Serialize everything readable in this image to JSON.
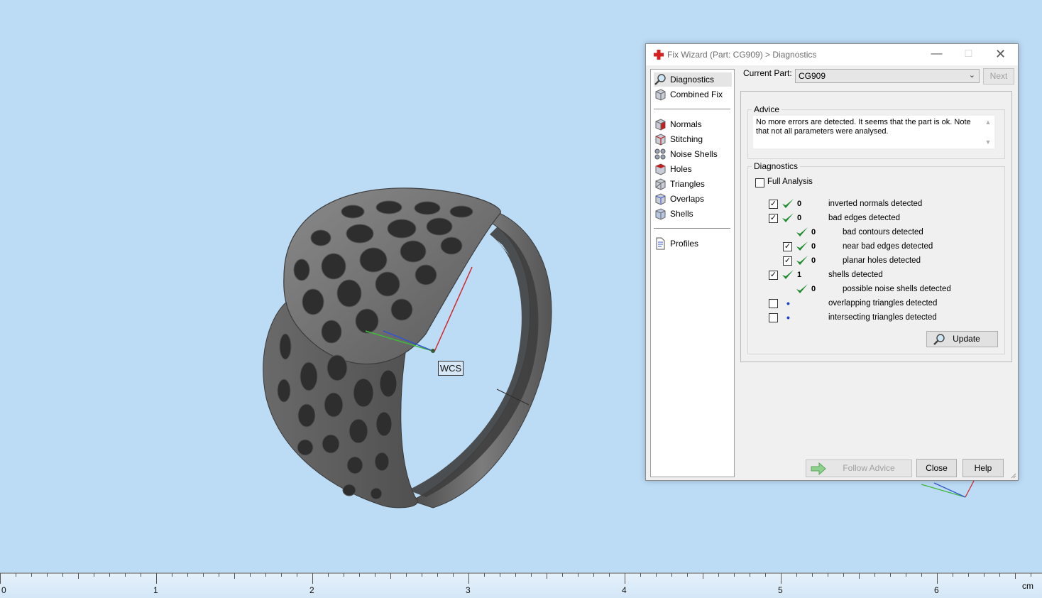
{
  "viewport": {
    "wcs_label": "WCS"
  },
  "ruler": {
    "ticks": [
      "0",
      "1",
      "2",
      "3",
      "4",
      "5",
      "6"
    ],
    "unit": "cm"
  },
  "dialog": {
    "title": "Fix Wizard (Part: CG909) > Diagnostics",
    "nav": {
      "diagnostics": "Diagnostics",
      "combined_fix": "Combined Fix",
      "normals": "Normals",
      "stitching": "Stitching",
      "noise_shells": "Noise Shells",
      "holes": "Holes",
      "triangles": "Triangles",
      "overlaps": "Overlaps",
      "shells": "Shells",
      "profiles": "Profiles"
    },
    "current_part_label": "Current Part:",
    "current_part_value": "CG909",
    "next_label": "Next",
    "advice": {
      "title": "Advice",
      "text": "No more errors are detected. It seems that the part is ok. Note that not all parameters were analysed."
    },
    "diagnostics": {
      "title": "Diagnostics",
      "full_analysis_label": "Full Analysis",
      "full_analysis_checked": false,
      "rows": [
        {
          "checkbox": true,
          "checked": true,
          "status": "ok",
          "count": "0",
          "label": "inverted normals detected"
        },
        {
          "checkbox": true,
          "checked": true,
          "status": "ok",
          "count": "0",
          "label": "bad edges detected"
        },
        {
          "checkbox": false,
          "checked": false,
          "status": "ok",
          "count": "0",
          "label": "bad contours detected"
        },
        {
          "checkbox": true,
          "checked": true,
          "status": "ok",
          "count": "0",
          "label": "near bad edges detected"
        },
        {
          "checkbox": true,
          "checked": true,
          "status": "ok",
          "count": "0",
          "label": "planar holes detected"
        },
        {
          "checkbox": true,
          "checked": true,
          "status": "ok",
          "count": "1",
          "label": "shells detected"
        },
        {
          "checkbox": false,
          "checked": false,
          "status": "ok",
          "count": "0",
          "label": "possible noise shells detected"
        },
        {
          "checkbox": true,
          "checked": false,
          "status": "pending",
          "count": "",
          "label": "overlapping triangles detected"
        },
        {
          "checkbox": true,
          "checked": false,
          "status": "pending",
          "count": "",
          "label": "intersecting triangles detected"
        }
      ],
      "update_label": "Update"
    },
    "buttons": {
      "follow_advice": "Follow Advice",
      "close": "Close",
      "help": "Help"
    }
  },
  "colors": {
    "background": "#bcdcf6",
    "check_green": "#1f8a2e",
    "axis_x": "#d4282a",
    "axis_y": "#3fb83f",
    "axis_z": "#3355cc"
  }
}
